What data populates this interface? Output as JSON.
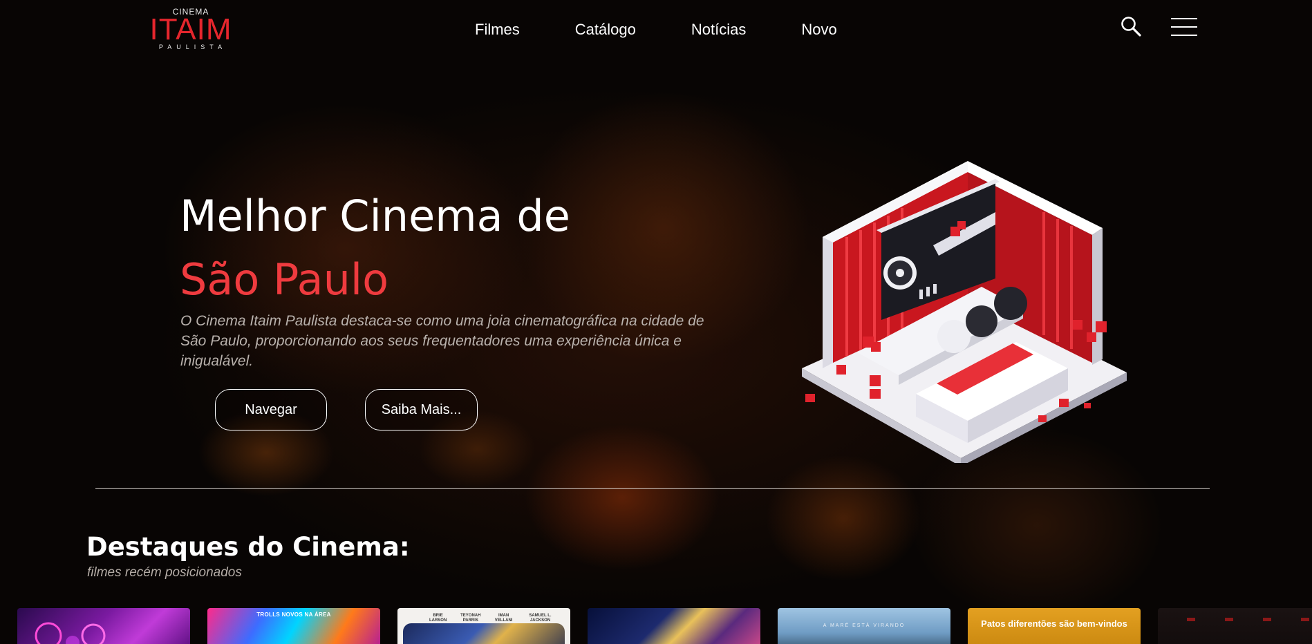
{
  "brand": {
    "top": "CINEMA",
    "main": "ITAIM",
    "bottom": "PAULISTA"
  },
  "nav": {
    "items": [
      {
        "label": "Filmes"
      },
      {
        "label": "Catálogo"
      },
      {
        "label": "Notícias"
      },
      {
        "label": "Novo"
      }
    ]
  },
  "header_icons": {
    "search": "search-icon",
    "menu": "hamburger-menu-icon"
  },
  "hero": {
    "title": "Melhor Cinema de",
    "title_accent": "São Paulo",
    "description": "O Cinema Itaim Paulista destaca-se como uma joia cinematográfica na cidade de São Paulo, proporcionando aos seus frequentadores uma experiência única e inigualável.",
    "primary_button": "Navegar",
    "secondary_button": "Saiba Mais...",
    "accent_color": "#ef3b3f"
  },
  "highlights": {
    "title": "Destaques do Cinema:",
    "subtitle": "filmes recém posicionados",
    "posters": [
      {
        "caption": ""
      },
      {
        "caption": "TROLLS NOVOS NA ÁREA"
      },
      {
        "caption": "",
        "names": [
          "BRIE LARSON",
          "TEYONAH PARRIS",
          "IMAN VELLANI",
          "SAMUEL L. JACKSON"
        ]
      },
      {
        "caption": ""
      },
      {
        "caption": "A MARÉ ESTÁ VIRANDO"
      },
      {
        "caption": "Patos diferentões são bem-vindos"
      },
      {
        "caption": ""
      }
    ]
  }
}
